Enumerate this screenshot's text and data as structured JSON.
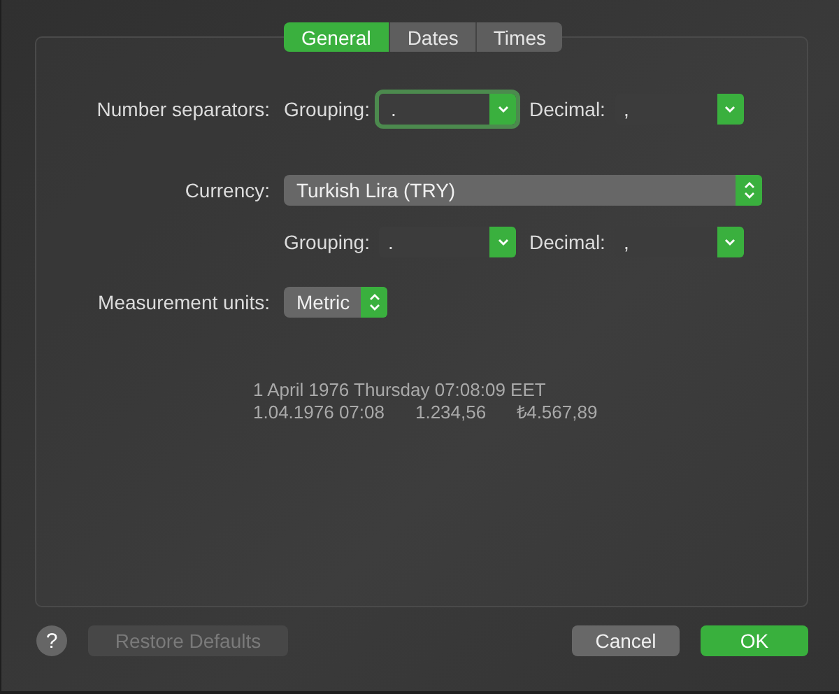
{
  "tabs": [
    {
      "label": "General",
      "selected": true
    },
    {
      "label": "Dates",
      "selected": false
    },
    {
      "label": "Times",
      "selected": false
    }
  ],
  "number_separators": {
    "label": "Number separators:",
    "grouping": {
      "label": "Grouping:",
      "value": ".",
      "focused": true
    },
    "decimal": {
      "label": "Decimal:",
      "value": ",",
      "focused": false
    }
  },
  "currency": {
    "label": "Currency:",
    "value": "Turkish Lira (TRY)",
    "grouping": {
      "label": "Grouping:",
      "value": ".",
      "focused": false
    },
    "decimal": {
      "label": "Decimal:",
      "value": ",",
      "focused": false
    }
  },
  "measurement_units": {
    "label": "Measurement units:",
    "value": "Metric"
  },
  "preview": {
    "long_date": "1 April 1976 Thursday 07:08:09 EET",
    "short_date": "1.04.1976 07:08",
    "number": "1.234,56",
    "currency": "₺4.567,89"
  },
  "buttons": [
    {
      "kind": "help",
      "label": "?"
    },
    {
      "kind": "button",
      "label": "Restore Defaults",
      "disabled": true,
      "default": false
    },
    {
      "kind": "button",
      "label": "Cancel",
      "disabled": false,
      "default": false
    },
    {
      "kind": "button",
      "label": "OK",
      "disabled": false,
      "default": true
    }
  ]
}
